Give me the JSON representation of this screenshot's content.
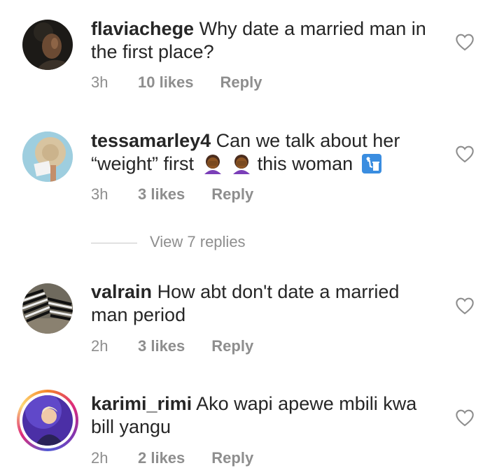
{
  "comments": [
    {
      "username": "flaviachege",
      "text": "Why date a married man in the first place?",
      "time": "3h",
      "likes": "10 likes",
      "reply": "Reply",
      "avatar_icon": "avatar-dark-portrait"
    },
    {
      "username": "tessamarley4",
      "text_part1": "Can we talk about her “weight” first",
      "text_part2": "this woman",
      "time": "3h",
      "likes": "3 likes",
      "reply": "Reply",
      "avatar_icon": "avatar-sunhat-beach",
      "emojis": [
        "facepalm-woman-emoji",
        "facepalm-woman-emoji",
        "litter-bin-emoji"
      ]
    },
    {
      "username": "valrain",
      "text": "How abt don't date a married man period",
      "time": "2h",
      "likes": "3 likes",
      "reply": "Reply",
      "avatar_icon": "avatar-zebras"
    },
    {
      "username": "karimi_rimi",
      "text": "Ako wapi apewe mbili kwa bill yangu",
      "time": "2h",
      "likes": "2 likes",
      "reply": "Reply",
      "avatar_icon": "avatar-story-ring"
    }
  ],
  "view_replies": "View 7 replies",
  "colors": {
    "text": "#262626",
    "muted": "#8e8e8e",
    "line": "#c7c7c7"
  },
  "icons": {
    "like": "heart-outline-icon"
  }
}
